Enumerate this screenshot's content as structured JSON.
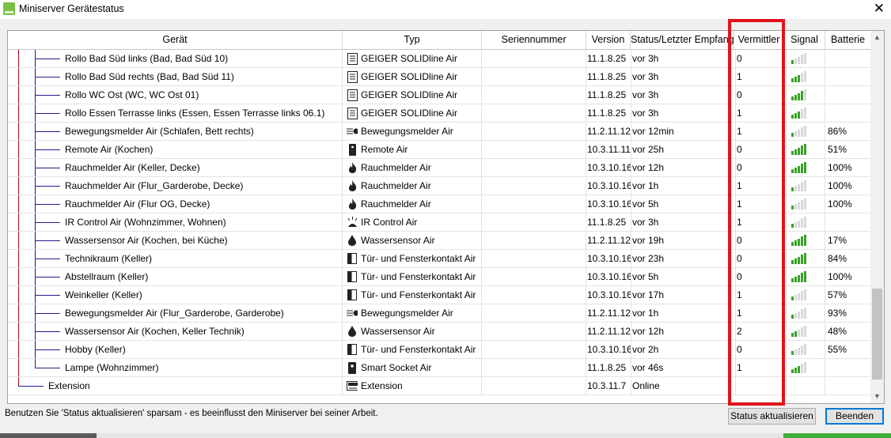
{
  "window": {
    "title": "Miniserver Gerätestatus",
    "close_glyph": "✕"
  },
  "columns": [
    "Gerät",
    "Typ",
    "Seriennummer",
    "Version",
    "Status/Letzter Empfang",
    "Vermittler",
    "Signal",
    "Batterie"
  ],
  "rows": [
    {
      "device": "Rollo Bad Süd links (Bad, Bad Süd 10)",
      "type": "GEIGER SOLIDline Air",
      "icon": "shutter-icon",
      "version": "11.1.8.25",
      "status": "vor 3h",
      "vermittler": "0",
      "signal": 1,
      "battery": ""
    },
    {
      "device": "Rollo Bad Süd rechts (Bad, Bad Süd 11)",
      "type": "GEIGER SOLIDline Air",
      "icon": "shutter-icon",
      "version": "11.1.8.25",
      "status": "vor 3h",
      "vermittler": "1",
      "signal": 3,
      "battery": ""
    },
    {
      "device": "Rollo WC Ost (WC, WC Ost 01)",
      "type": "GEIGER SOLIDline Air",
      "icon": "shutter-icon",
      "version": "11.1.8.25",
      "status": "vor 3h",
      "vermittler": "0",
      "signal": 4,
      "battery": ""
    },
    {
      "device": "Rollo Essen Terrasse links (Essen, Essen Terrasse links 06.1)",
      "type": "GEIGER SOLIDline Air",
      "icon": "shutter-icon",
      "version": "11.1.8.25",
      "status": "vor 3h",
      "vermittler": "1",
      "signal": 3,
      "battery": ""
    },
    {
      "device": "Bewegungsmelder Air (Schlafen, Bett rechts)",
      "type": "Bewegungsmelder Air",
      "icon": "motion-sensor-icon",
      "version": "11.2.11.12",
      "status": "vor 12min",
      "vermittler": "1",
      "signal": 1,
      "battery": "86%"
    },
    {
      "device": "Remote Air (Kochen)",
      "type": "Remote Air",
      "icon": "remote-icon",
      "version": "10.3.11.11",
      "status": "vor 25h",
      "vermittler": "0",
      "signal": 5,
      "battery": "51%"
    },
    {
      "device": "Rauchmelder Air (Keller, Decke)",
      "type": "Rauchmelder Air",
      "icon": "flame-icon",
      "version": "10.3.10.16",
      "status": "vor 12h",
      "vermittler": "0",
      "signal": 5,
      "battery": "100%"
    },
    {
      "device": "Rauchmelder Air (Flur_Garderobe, Decke)",
      "type": "Rauchmelder Air",
      "icon": "flame-icon",
      "version": "10.3.10.16",
      "status": "vor 1h",
      "vermittler": "1",
      "signal": 1,
      "battery": "100%"
    },
    {
      "device": "Rauchmelder Air (Flur OG, Decke)",
      "type": "Rauchmelder Air",
      "icon": "flame-icon",
      "version": "10.3.10.16",
      "status": "vor 5h",
      "vermittler": "1",
      "signal": 1,
      "battery": "100%"
    },
    {
      "device": "IR Control Air (Wohnzimmer, Wohnen)",
      "type": "IR Control Air",
      "icon": "ir-control-icon",
      "version": "11.1.8.25",
      "status": "vor 3h",
      "vermittler": "1",
      "signal": 1,
      "battery": ""
    },
    {
      "device": "Wassersensor Air (Kochen, bei Küche)",
      "type": "Wassersensor Air",
      "icon": "water-drop-icon",
      "version": "11.2.11.12",
      "status": "vor 19h",
      "vermittler": "0",
      "signal": 5,
      "battery": "17%"
    },
    {
      "device": "Technikraum (Keller)",
      "type": "Tür- und Fensterkontakt Air",
      "icon": "door-contact-icon",
      "version": "10.3.10.16",
      "status": "vor 23h",
      "vermittler": "0",
      "signal": 5,
      "battery": "84%"
    },
    {
      "device": "Abstellraum (Keller)",
      "type": "Tür- und Fensterkontakt Air",
      "icon": "door-contact-icon",
      "version": "10.3.10.16",
      "status": "vor 5h",
      "vermittler": "0",
      "signal": 5,
      "battery": "100%"
    },
    {
      "device": "Weinkeller (Keller)",
      "type": "Tür- und Fensterkontakt Air",
      "icon": "door-contact-icon",
      "version": "10.3.10.16",
      "status": "vor 17h",
      "vermittler": "1",
      "signal": 1,
      "battery": "57%"
    },
    {
      "device": "Bewegungsmelder Air (Flur_Garderobe, Garderobe)",
      "type": "Bewegungsmelder Air",
      "icon": "motion-sensor-icon",
      "version": "11.2.11.12",
      "status": "vor 1h",
      "vermittler": "1",
      "signal": 1,
      "battery": "93%"
    },
    {
      "device": "Wassersensor Air (Kochen, Keller Technik)",
      "type": "Wassersensor Air",
      "icon": "water-drop-icon",
      "version": "11.2.11.12",
      "status": "vor 12h",
      "vermittler": "2",
      "signal": 2,
      "battery": "48%"
    },
    {
      "device": "Hobby (Keller)",
      "type": "Tür- und Fensterkontakt Air",
      "icon": "door-contact-icon",
      "version": "10.3.10.16",
      "status": "vor 2h",
      "vermittler": "0",
      "signal": 1,
      "battery": "55%"
    },
    {
      "device": "Lampe (Wohnzimmer)",
      "type": "Smart Socket Air",
      "icon": "smart-socket-icon",
      "version": "11.1.8.25",
      "status": "vor 46s",
      "vermittler": "1",
      "signal": 3,
      "battery": ""
    },
    {
      "device": "Extension",
      "type": "Extension",
      "icon": "extension-icon",
      "version": "10.3.11.7",
      "status": "Online",
      "vermittler": "",
      "signal": 0,
      "battery": "",
      "level": "extension"
    }
  ],
  "signal_colors": {
    "on": "#3aa02a",
    "off": "#d9d9d9"
  },
  "accent_highlight": "#e2131c",
  "footer": {
    "hint": "Benutzen Sie 'Status aktualisieren' sparsam - es beeinflusst den Miniserver bei seiner Arbeit.",
    "refresh_label": "Status aktualisieren",
    "quit_label": "Beenden"
  }
}
